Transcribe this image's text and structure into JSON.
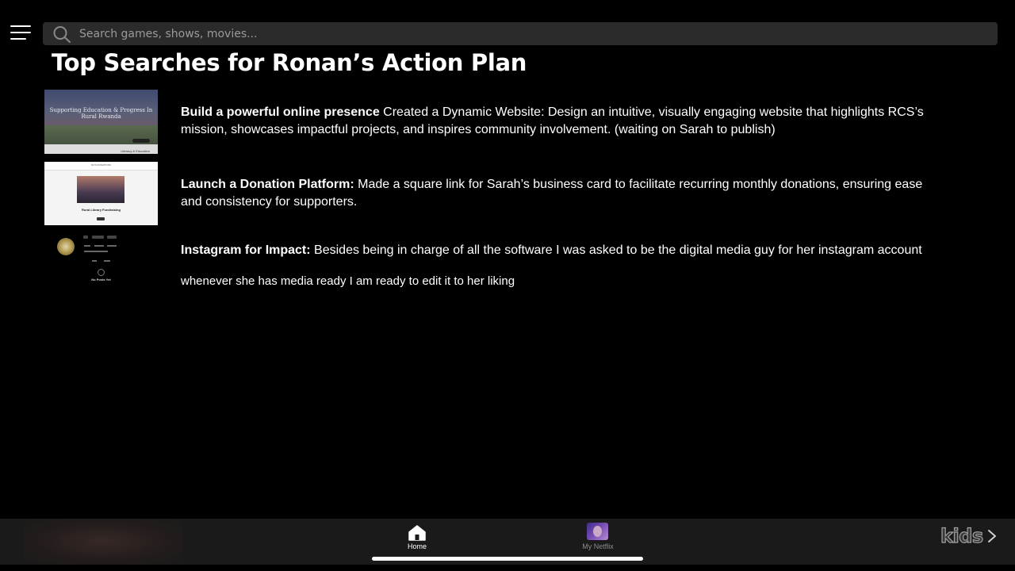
{
  "search": {
    "placeholder": "Search games, shows, movies..."
  },
  "page_title": "Top Searches for Ronan’s Action Plan",
  "rows": [
    {
      "heading": "Build a powerful online presence",
      "body": " Created a Dynamic Website: Design an intuitive, visually engaging website that highlights RCS’s mission, showcases impactful projects, and inspires community involvement. (waiting on Sarah to publish)",
      "thumb_text": "Supporting Education & Progress In Rural Rwanda",
      "thumb_strip_label": "Literacy & Education"
    },
    {
      "heading": "Launch a Donation Platform:",
      "body": " Made a square link for Sarah’s business card to facilitate recurring monthly donations, ensuring ease and consistency for supporters.",
      "thumb_title": "Rural Library Fundraising",
      "thumb_header": "RCS DONATIONS"
    },
    {
      "heading": "Instagram for Impact:",
      "body": " Besides being in charge of all the software I was asked to be the digital media guy for her instagram account",
      "body_line2": "whenever she has media ready I am ready to edit it to her liking",
      "thumb_text": "No Posts Yet"
    }
  ],
  "bottom_nav": {
    "home_label": "Home",
    "my_netflix_label": "My Netflix",
    "kids_label": "kids"
  },
  "icons": {
    "menu": "hamburger-menu-icon",
    "search": "search-icon",
    "home": "home-icon",
    "chevron": "chevron-right-icon"
  },
  "colors": {
    "background": "#000000",
    "search_bar": "#2b2b2b",
    "bottom_bar": "#1a1a1a",
    "inactive_label": "#8c8c8c"
  }
}
